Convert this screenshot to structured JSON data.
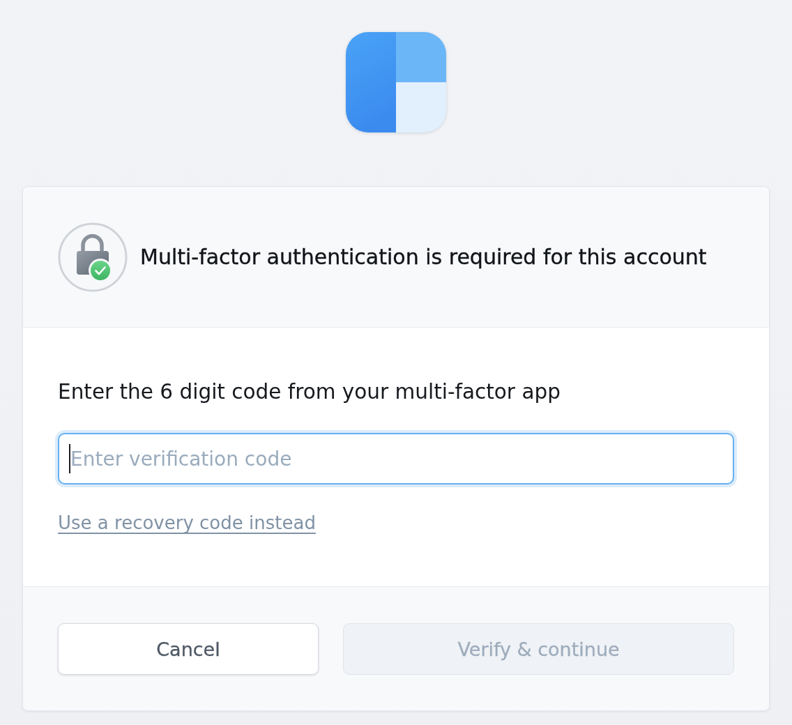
{
  "header": {
    "title": "Multi-factor authentication is required for this account"
  },
  "form": {
    "prompt": "Enter the 6 digit code from your multi-factor app",
    "code_field": {
      "placeholder": "Enter verification code",
      "focused": true
    },
    "recovery_link": "Use a recovery code instead"
  },
  "footer": {
    "buttons": [
      {
        "label": "Cancel",
        "kind": "secondary",
        "disabled": false
      },
      {
        "label": "Verify & continue",
        "kind": "primary",
        "disabled": true
      }
    ]
  }
}
